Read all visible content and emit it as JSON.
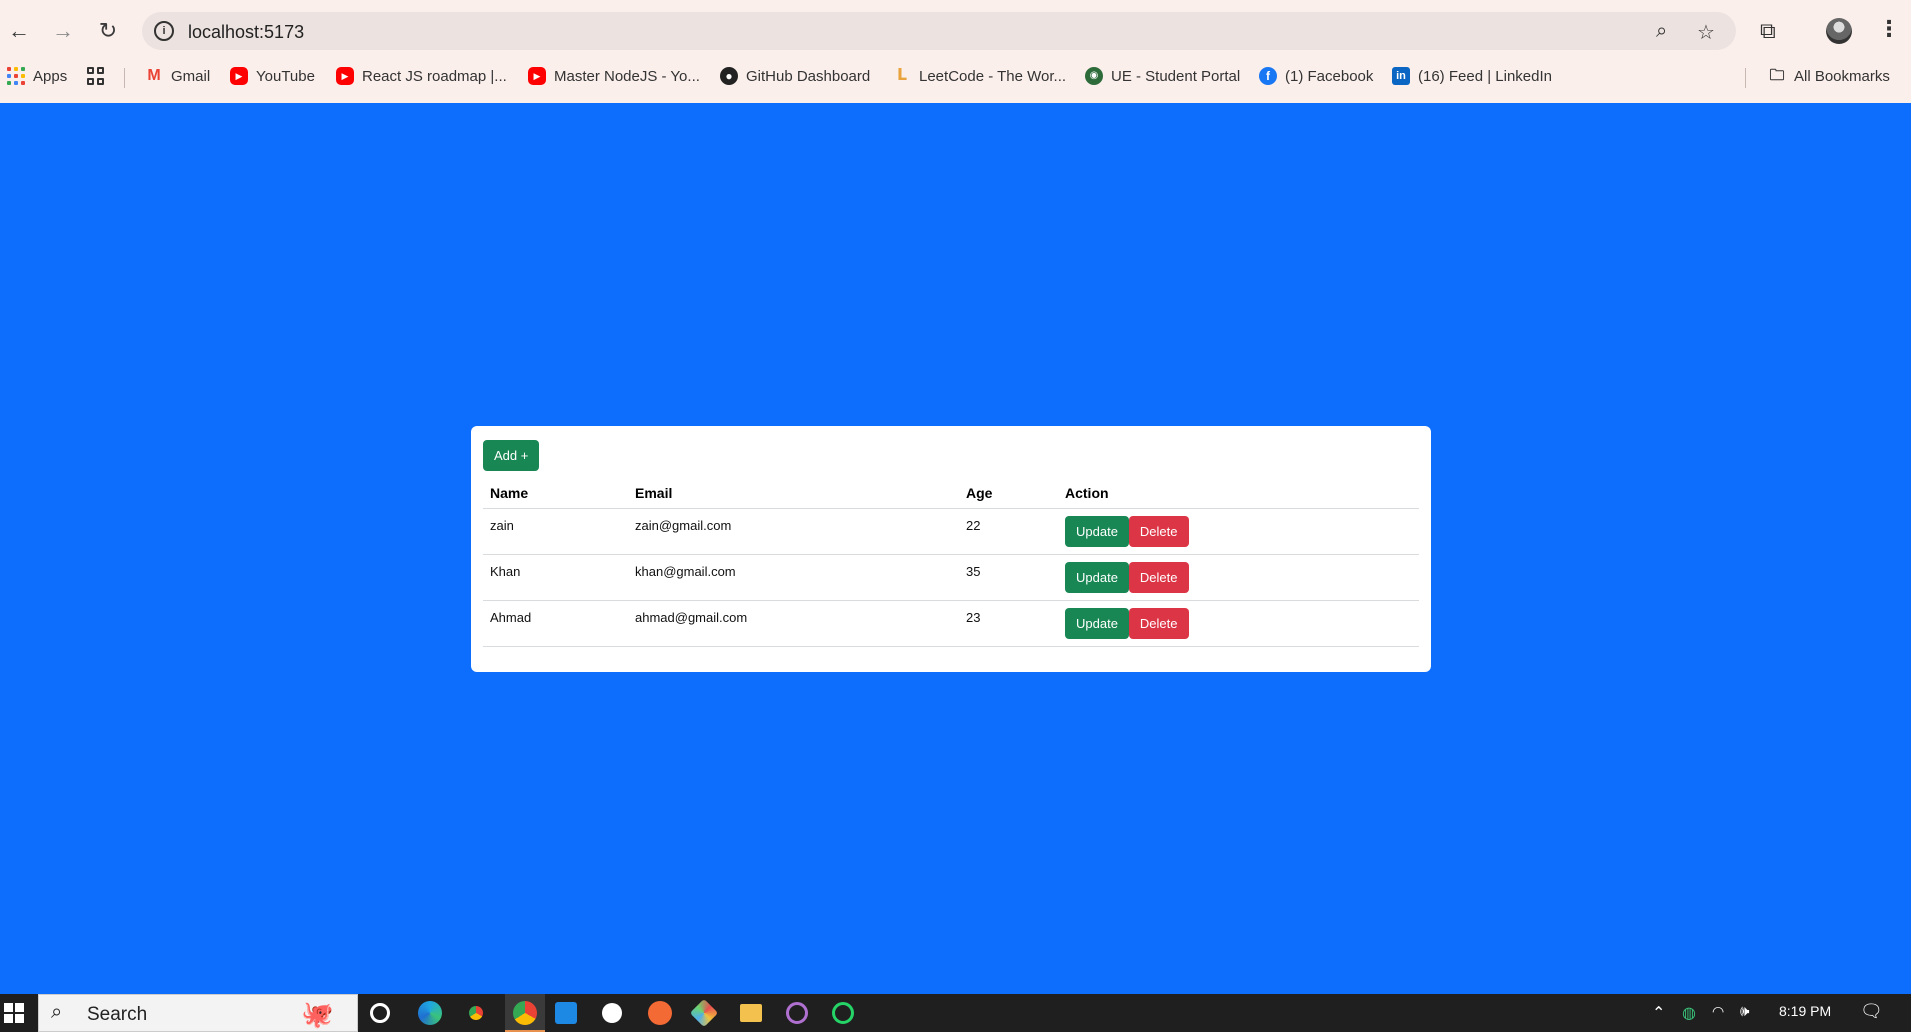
{
  "browser": {
    "url": "localhost:5173",
    "bookmarks": [
      {
        "label": "Apps",
        "icon": "apps-grid-icon"
      },
      {
        "label": "Gmail",
        "icon": "gmail-icon"
      },
      {
        "label": "YouTube",
        "icon": "youtube-icon"
      },
      {
        "label": "React JS roadmap |...",
        "icon": "youtube-icon"
      },
      {
        "label": "Master NodeJS - Yo...",
        "icon": "youtube-icon"
      },
      {
        "label": "GitHub Dashboard",
        "icon": "github-icon"
      },
      {
        "label": "LeetCode - The Wor...",
        "icon": "leetcode-icon"
      },
      {
        "label": "UE - Student Portal",
        "icon": "ue-portal-icon"
      },
      {
        "label": "(1) Facebook",
        "icon": "facebook-icon"
      },
      {
        "label": "(16) Feed | LinkedIn",
        "icon": "linkedin-icon"
      }
    ],
    "all_bookmarks": "All Bookmarks"
  },
  "app": {
    "add_button": "Add +",
    "table": {
      "headers": [
        "Name",
        "Email",
        "Age",
        "Action"
      ],
      "rows": [
        {
          "name": "zain",
          "email": "zain@gmail.com",
          "age": "22"
        },
        {
          "name": "Khan",
          "email": "khan@gmail.com",
          "age": "35"
        },
        {
          "name": "Ahmad",
          "email": "ahmad@gmail.com",
          "age": "23"
        }
      ],
      "update_label": "Update",
      "delete_label": "Delete"
    },
    "colors": {
      "background": "#0d6efd",
      "success": "#198754",
      "danger": "#dc3545"
    }
  },
  "taskbar": {
    "search_label": "Search",
    "time": "8:19 PM"
  }
}
